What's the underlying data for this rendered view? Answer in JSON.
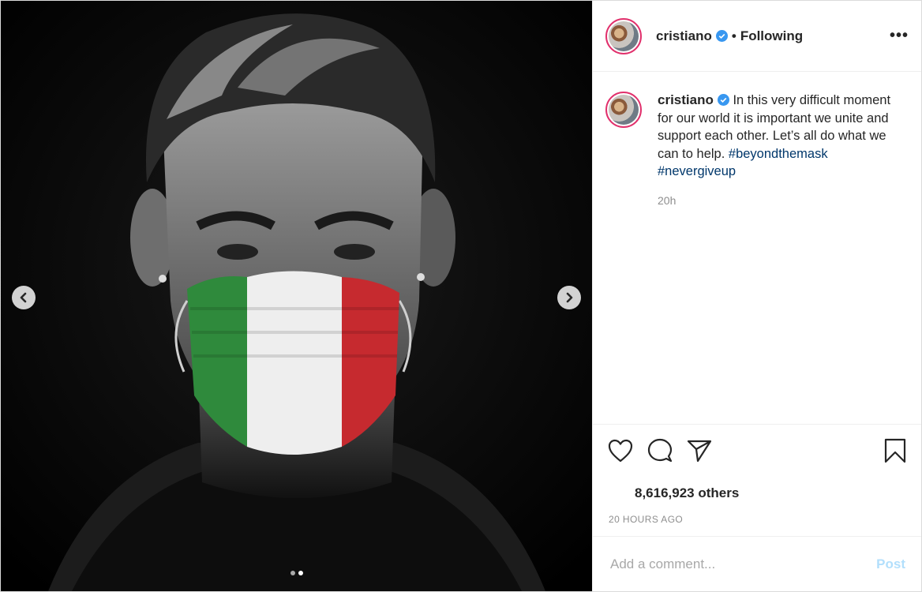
{
  "post": {
    "username": "cristiano",
    "follow_status": "Following",
    "follow_separator": "•",
    "more_label": "•••",
    "caption": "In this very difficult moment for our world it is important we unite and support each other. Let’s all do what we can to help.",
    "hashtags": [
      "#beyondthemask",
      "#nevergiveup"
    ],
    "caption_time": "20h",
    "likes_text": "8,616,923 others",
    "posted_ago": "20 HOURS AGO"
  },
  "carousel": {
    "slide_count": 2,
    "active_index": 1
  },
  "comment_box": {
    "placeholder": "Add a comment...",
    "post_label": "Post"
  },
  "colors": {
    "verified": "#3897f0",
    "hashtag": "#00376b",
    "post_button_disabled": "#b2dffc",
    "mask_green": "#2f8a3c",
    "mask_white": "#eeeeee",
    "mask_red": "#c62a2f"
  },
  "icons": [
    "chevron-left-icon",
    "chevron-right-icon",
    "verified-badge-icon",
    "more-options-icon",
    "heart-icon",
    "comment-icon",
    "share-icon",
    "bookmark-icon"
  ]
}
